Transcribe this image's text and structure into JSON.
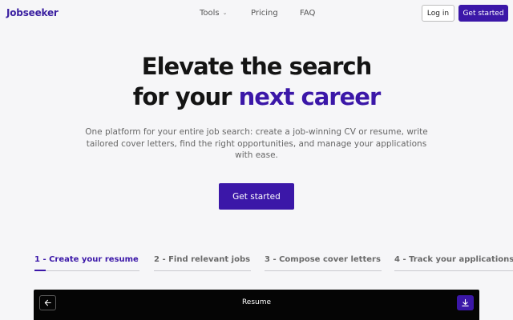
{
  "brand": {
    "logo_text": "Jobseeker",
    "accent_color": "#3b17a8"
  },
  "nav": {
    "links": [
      {
        "label": "Tools",
        "has_dropdown": true
      },
      {
        "label": "Pricing"
      },
      {
        "label": "FAQ"
      }
    ],
    "login_label": "Log in",
    "get_started_label": "Get started"
  },
  "hero": {
    "title_line1": "Elevate the search",
    "title_line2_prefix": "for your ",
    "title_line2_accent": "next career",
    "subtitle": "One platform for your entire job search: create a job-winning CV or resume, write tailored cover letters, find the right opportunities, and manage your applications with ease.",
    "cta_label": "Get started"
  },
  "tabs": [
    {
      "label": "1 - Create your resume",
      "active": true
    },
    {
      "label": "2 - Find relevant jobs",
      "active": false
    },
    {
      "label": "3 - Compose cover letters",
      "active": false
    },
    {
      "label": "4 - Track your applications",
      "active": false
    }
  ],
  "panel": {
    "title": "Resume",
    "back_icon": "arrow-left-icon",
    "download_icon": "download-icon"
  }
}
